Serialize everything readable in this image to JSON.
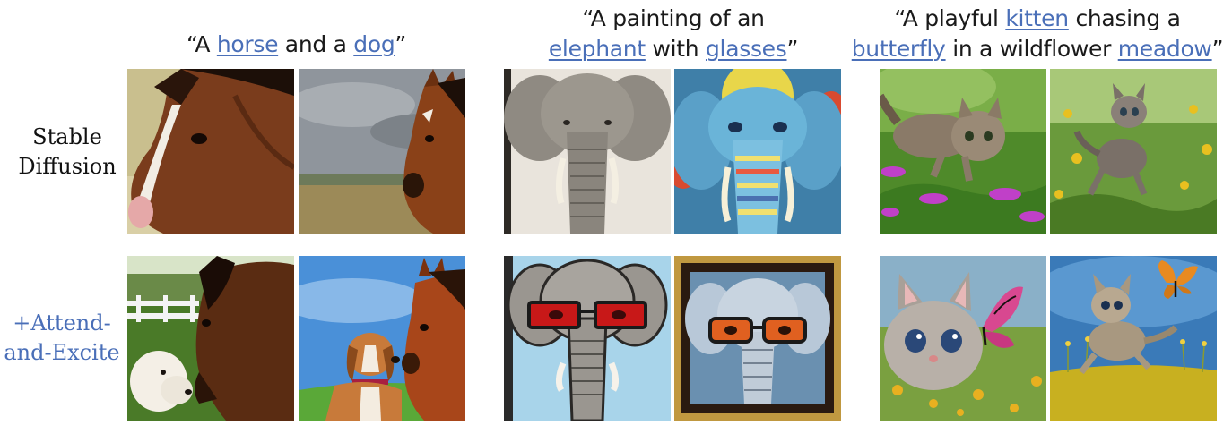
{
  "columns": [
    {
      "caption_lines": [
        [
          {
            "t": "“A "
          },
          {
            "t": "horse",
            "kw": true
          },
          {
            "t": " and a "
          },
          {
            "t": "dog",
            "kw": true
          },
          {
            "t": "”"
          }
        ]
      ]
    },
    {
      "caption_lines": [
        [
          {
            "t": "“A painting of an"
          }
        ],
        [
          {
            "t": "elephant",
            "kw": true
          },
          {
            "t": " with "
          },
          {
            "t": "glasses",
            "kw": true
          },
          {
            "t": "”"
          }
        ]
      ]
    },
    {
      "caption_lines": [
        [
          {
            "t": "“A playful "
          },
          {
            "t": "kitten",
            "kw": true
          },
          {
            "t": " chasing a"
          }
        ],
        [
          {
            "t": "butterfly",
            "kw": true
          },
          {
            "t": " in a wildflower "
          },
          {
            "t": "meadow",
            "kw": true
          },
          {
            "t": "”"
          }
        ]
      ]
    }
  ],
  "rows": [
    {
      "label_lines": [
        "Stable",
        "Diffusion"
      ],
      "color": "#111111"
    },
    {
      "label_lines": [
        "+Attend-",
        "and-Excite"
      ],
      "color": "#4a6fb8"
    }
  ],
  "colors": {
    "keyword": "#4a6fb8",
    "text": "#1a1a1a"
  }
}
